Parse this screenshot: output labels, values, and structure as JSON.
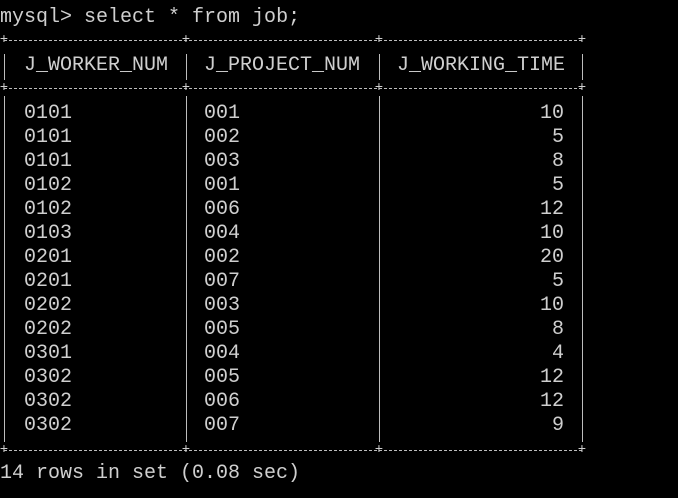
{
  "terminal": {
    "prompt": "mysql>",
    "command": "select * from job;",
    "summary": "14 rows in set (0.08 sec)"
  },
  "table": {
    "columns": [
      "J_WORKER_NUM",
      "J_PROJECT_NUM",
      "J_WORKING_TIME"
    ],
    "rows": [
      [
        "0101",
        "001",
        "10"
      ],
      [
        "0101",
        "002",
        "5"
      ],
      [
        "0101",
        "003",
        "8"
      ],
      [
        "0102",
        "001",
        "5"
      ],
      [
        "0102",
        "006",
        "12"
      ],
      [
        "0103",
        "004",
        "10"
      ],
      [
        "0201",
        "002",
        "20"
      ],
      [
        "0201",
        "007",
        "5"
      ],
      [
        "0202",
        "003",
        "10"
      ],
      [
        "0202",
        "005",
        "8"
      ],
      [
        "0301",
        "004",
        "4"
      ],
      [
        "0302",
        "005",
        "12"
      ],
      [
        "0302",
        "006",
        "12"
      ],
      [
        "0302",
        "007",
        "9"
      ]
    ]
  },
  "colors": {
    "background": "#000000",
    "text": "#cfcfcf"
  }
}
